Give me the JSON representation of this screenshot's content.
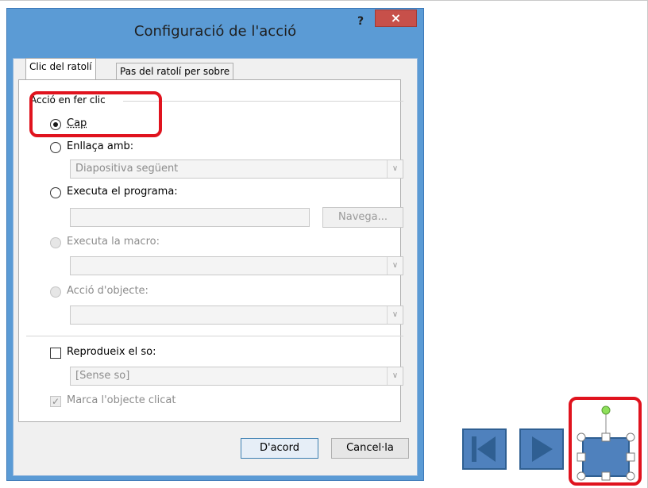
{
  "dialog": {
    "title": "Configuració de l'acció",
    "help_label": "?",
    "close_label": "×"
  },
  "tabs": [
    {
      "label": "Clic del ratolí",
      "active": true
    },
    {
      "label": "Pas del ratolí per sobre",
      "active": false
    }
  ],
  "action_group": {
    "label": "Acció en fer clic",
    "options": {
      "none": {
        "label": "Cap",
        "checked": true,
        "enabled": true
      },
      "link": {
        "label": "Enllaça amb:",
        "checked": false,
        "enabled": true,
        "value": "Diapositiva següent"
      },
      "run_program": {
        "label": "Executa el programa:",
        "checked": false,
        "enabled": true,
        "value": "",
        "browse_label": "Navega..."
      },
      "run_macro": {
        "label": "Executa la macro:",
        "checked": false,
        "enabled": false,
        "value": ""
      },
      "object_action": {
        "label": "Acció d'objecte:",
        "checked": false,
        "enabled": false,
        "value": ""
      }
    }
  },
  "sound": {
    "label": "Reprodueix el so:",
    "checked": false,
    "value": "[Sense so]"
  },
  "highlight_click": {
    "label": "Marca l'objecte clicat",
    "checked": true,
    "enabled": false
  },
  "buttons": {
    "ok_label": "D'acord",
    "cancel_label": "Cancel·la"
  },
  "colors": {
    "title_bar": "#5b9bd5",
    "close_button": "#c7504a",
    "highlight": "#e0131e",
    "slide_button": "#4f81bd",
    "rotation_handle": "#8ee05a"
  },
  "slide_controls": {
    "icons": [
      "previous-slide-icon",
      "next-slide-icon",
      "blank-action-button-icon"
    ]
  }
}
